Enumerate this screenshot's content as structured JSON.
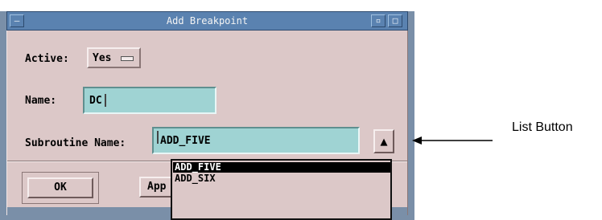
{
  "window": {
    "title": "Add Breakpoint",
    "menu_glyph": "—",
    "minimize_glyph": "▫",
    "maximize_glyph": "□"
  },
  "form": {
    "active_label": "Active:",
    "active_value": "Yes",
    "name_label": "Name:",
    "name_value": "DC",
    "subroutine_label": "Subroutine Name:",
    "subroutine_value": "ADD_FIVE"
  },
  "list_button_glyph": "▲",
  "dropdown": {
    "items": [
      "ADD_FIVE",
      "ADD_SIX"
    ],
    "selected_index": 0
  },
  "buttons": {
    "ok": "OK",
    "apply": "App"
  },
  "annotation": {
    "text": "List Button"
  },
  "colors": {
    "panel": "#dcc8c8",
    "titlebar": "#5a82b0",
    "field": "#9fd3d3"
  }
}
